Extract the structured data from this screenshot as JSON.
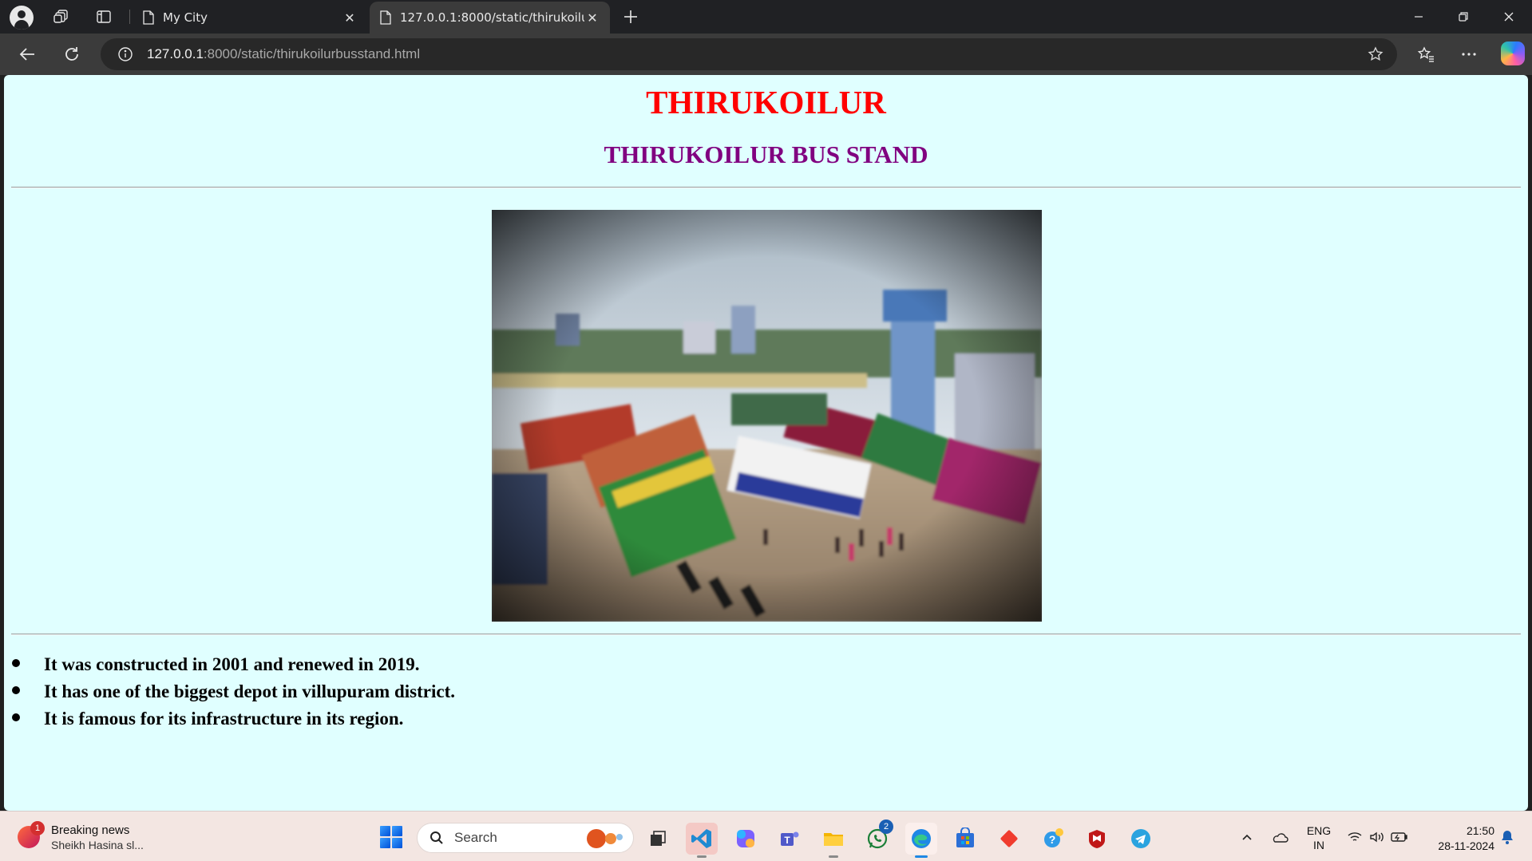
{
  "browser": {
    "tabs": [
      {
        "title": "My City",
        "active": false
      },
      {
        "title": "127.0.0.1:8000/static/thirukoilurbusstand.html",
        "active": true
      }
    ],
    "address": {
      "host": "127.0.0.1",
      "rest": ":8000/static/thirukoilurbusstand.html"
    }
  },
  "page": {
    "title": "THIRUKOILUR",
    "subtitle": "THIRUKOILUR BUS STAND",
    "facts": [
      "It was constructed in 2001 and renewed in 2019.",
      "It has one of the biggest depot in villupuram district.",
      "It is famous for its infrastructure in its region."
    ],
    "colors": {
      "background": "#e0ffff",
      "title": "#ff0000",
      "subtitle": "#800080"
    }
  },
  "taskbar": {
    "news": {
      "badge": "1",
      "title": "Breaking news",
      "subtitle": "Sheikh Hasina sl..."
    },
    "search_placeholder": "Search",
    "whatsapp_badge": "2",
    "apps": [
      "start-icon",
      "task-view-icon",
      "vscode-icon",
      "copilot-icon",
      "teams-icon",
      "file-explorer-icon",
      "whatsapp-icon",
      "edge-icon",
      "store-icon",
      "git-icon",
      "help-icon",
      "mcafee-icon",
      "telegram-icon"
    ],
    "language": {
      "line1": "ENG",
      "line2": "IN"
    },
    "clock": {
      "time": "21:50",
      "date": "28-11-2024"
    }
  }
}
